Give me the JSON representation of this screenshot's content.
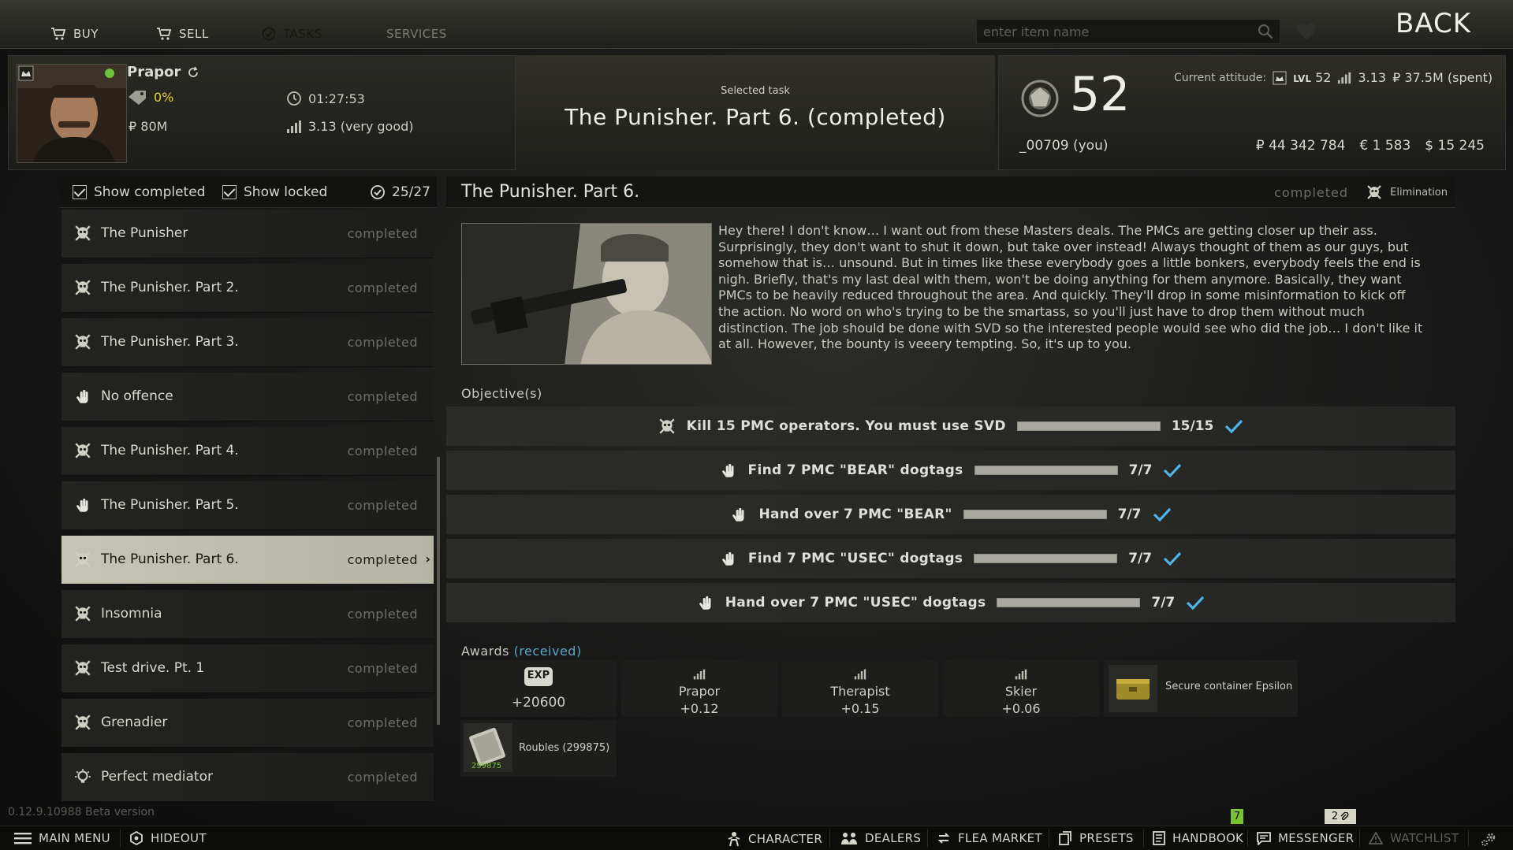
{
  "nav": {
    "tabs": [
      {
        "label": "BUY",
        "icon": "cart-icon"
      },
      {
        "label": "SELL",
        "icon": "cart-icon"
      },
      {
        "label": "TASKS",
        "icon": "check-circle-icon"
      },
      {
        "label": "SERVICES"
      }
    ],
    "search_placeholder": "enter item name",
    "back_label": "BACK"
  },
  "trader": {
    "name": "Prapor",
    "discount": "0%",
    "timer": "01:27:53",
    "money": "₽ 80M",
    "standing": "3.13 (very good)"
  },
  "selected_task": {
    "label": "Selected task",
    "title": "The Punisher. Part 6. (completed)"
  },
  "player": {
    "level": "52",
    "name": "_00709 (you)",
    "attitude_label": "Current attitude:",
    "lvl_prefix": "LVL",
    "lvl": "52",
    "standing": "3.13",
    "spent": "₽ 37.5M (spent)",
    "roubles": "₽ 44 342 784",
    "euros": "€ 1 583",
    "dollars": "$ 15 245"
  },
  "list_header": {
    "show_completed": "Show completed",
    "show_locked": "Show locked",
    "count": "25/27"
  },
  "tasks": [
    {
      "name": "The Punisher",
      "status": "completed",
      "icon": "skull-icon"
    },
    {
      "name": "The Punisher. Part 2.",
      "status": "completed",
      "icon": "skull-icon"
    },
    {
      "name": "The Punisher. Part 3.",
      "status": "completed",
      "icon": "skull-icon"
    },
    {
      "name": "No offence",
      "status": "completed",
      "icon": "hand-icon"
    },
    {
      "name": "The Punisher. Part 4.",
      "status": "completed",
      "icon": "skull-icon"
    },
    {
      "name": "The Punisher. Part 5.",
      "status": "completed",
      "icon": "hand-icon"
    },
    {
      "name": "The Punisher. Part 6.",
      "status": "completed",
      "icon": "skull-icon",
      "selected": true
    },
    {
      "name": "Insomnia",
      "status": "completed",
      "icon": "skull-icon"
    },
    {
      "name": "Test drive. Pt. 1",
      "status": "completed",
      "icon": "skull-icon"
    },
    {
      "name": "Grenadier",
      "status": "completed",
      "icon": "skull-icon"
    },
    {
      "name": "Perfect mediator",
      "status": "completed",
      "icon": "bulb-icon"
    }
  ],
  "detail": {
    "title": "The Punisher. Part 6.",
    "status": "completed",
    "type": "Elimination",
    "description": "Hey there! I don't know… I want out from these Masters deals. The PMCs are getting closer up their ass. Surprisingly, they don't want to shut it down, but take over instead!  Always thought of them as our guys, but somehow that is… unsound. But in times like these everybody goes a little bonkers, everybody feels the end is nigh. Briefly, that's my last deal with them, won't be doing anything for them anymore. Basically, they want PMCs to be heavily reduced throughout the area. And quickly. They'll drop in some misinformation to kick off the action. No word on who's trying to be the smartass, so you'll just have to drop them without much distinction. The job should be done with SVD so the interested people would see who did the job… I don't like it at all. However, the bounty is veeery tempting. So, it's up to you.",
    "objectives_label": "Objective(s)",
    "objectives": [
      {
        "text": "Kill 15 PMC operators. You must use SVD",
        "progress": "15/15",
        "fraction": 1,
        "icon": "skull-icon"
      },
      {
        "text": "Find 7 PMC \"BEAR\" dogtags",
        "progress": "7/7",
        "fraction": 1,
        "icon": "hand-icon"
      },
      {
        "text": "Hand over 7 PMC \"BEAR\"",
        "progress": "7/7",
        "fraction": 1,
        "icon": "hand-icon"
      },
      {
        "text": "Find 7 PMC \"USEC\" dogtags",
        "progress": "7/7",
        "fraction": 1,
        "icon": "hand-icon"
      },
      {
        "text": "Hand over 7 PMC \"USEC\" dogtags",
        "progress": "7/7",
        "fraction": 1,
        "icon": "hand-icon"
      }
    ],
    "awards_label": "Awards",
    "awards_status": "(received)",
    "awards": {
      "exp_badge": "EXP",
      "exp": "+20600",
      "standing": [
        {
          "trader": "Prapor",
          "value": "+0.12"
        },
        {
          "trader": "Therapist",
          "value": "+0.15"
        },
        {
          "trader": "Skier",
          "value": "+0.06"
        }
      ],
      "item_name": "Secure container Epsilon",
      "roubles_name": "Roubles (299875)",
      "roubles_stack": "299875"
    }
  },
  "footer": {
    "version": "0.12.9.10988 Beta version",
    "main_menu": "MAIN MENU",
    "hideout": "HIDEOUT",
    "character": "CHARACTER",
    "dealers": "DEALERS",
    "flea_market": "FLEA MARKET",
    "presets": "PRESETS",
    "handbook": "HANDBOOK",
    "messenger": "MESSENGER",
    "watchlist": "WATCHLIST",
    "notif_handbook": "7",
    "notif_messenger": "2"
  },
  "colors": {
    "check": "#4fb3e6",
    "received": "#5aa6c9",
    "discount": "#e7cf3a",
    "notif_green": "#79c231"
  }
}
